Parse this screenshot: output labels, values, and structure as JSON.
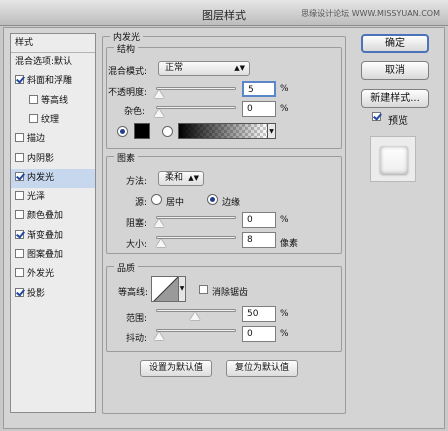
{
  "window": {
    "title": "图层样式",
    "watermark": "思缘设计论坛 WWW.MISSYUAN.COM"
  },
  "styles": {
    "header": "样式",
    "items": [
      {
        "label": "混合选项:默认",
        "checkbox": false,
        "checked": false,
        "sub": false
      },
      {
        "label": "斜面和浮雕",
        "checkbox": true,
        "checked": true,
        "sub": false
      },
      {
        "label": "等高线",
        "checkbox": true,
        "checked": false,
        "sub": true
      },
      {
        "label": "纹理",
        "checkbox": true,
        "checked": false,
        "sub": true
      },
      {
        "label": "描边",
        "checkbox": true,
        "checked": false,
        "sub": false
      },
      {
        "label": "内阴影",
        "checkbox": true,
        "checked": false,
        "sub": false
      },
      {
        "label": "内发光",
        "checkbox": true,
        "checked": true,
        "sub": false,
        "selected": true
      },
      {
        "label": "光泽",
        "checkbox": true,
        "checked": false,
        "sub": false
      },
      {
        "label": "颜色叠加",
        "checkbox": true,
        "checked": false,
        "sub": false
      },
      {
        "label": "渐变叠加",
        "checkbox": true,
        "checked": true,
        "sub": false
      },
      {
        "label": "图案叠加",
        "checkbox": true,
        "checked": false,
        "sub": false
      },
      {
        "label": "外发光",
        "checkbox": true,
        "checked": false,
        "sub": false
      },
      {
        "label": "投影",
        "checkbox": true,
        "checked": true,
        "sub": false
      }
    ]
  },
  "panel": {
    "title": "内发光",
    "structure": {
      "title": "结构",
      "blend_mode_label": "混合模式:",
      "blend_mode_value": "正常",
      "opacity_label": "不透明度:",
      "opacity_value": "5",
      "opacity_unit": "%",
      "opacity_fraction": 0.05,
      "noise_label": "杂色:",
      "noise_value": "0",
      "noise_unit": "%",
      "noise_fraction": 0.0,
      "color_selected": "solid",
      "glow_color": "#000000"
    },
    "elements": {
      "title": "图素",
      "method_label": "方法:",
      "method_value": "柔和",
      "source_label": "源:",
      "source_center": "居中",
      "source_edge": "边缘",
      "source_selected": "edge",
      "choke_label": "阻塞:",
      "choke_value": "0",
      "choke_unit": "%",
      "choke_fraction": 0.0,
      "size_label": "大小:",
      "size_value": "8",
      "size_unit": "像素",
      "size_fraction": 0.032
    },
    "quality": {
      "title": "品质",
      "contour_label": "等高线:",
      "antialias_label": "消除锯齿",
      "antialias_checked": false,
      "range_label": "范围:",
      "range_value": "50",
      "range_unit": "%",
      "range_fraction": 0.5,
      "jitter_label": "抖动:",
      "jitter_value": "0",
      "jitter_unit": "%",
      "jitter_fraction": 0.0
    },
    "make_default": "设置为默认值",
    "reset_default": "复位为默认值"
  },
  "actions": {
    "ok": "确定",
    "cancel": "取消",
    "new_style": "新建样式...",
    "preview_label": "预览",
    "preview_checked": true
  }
}
